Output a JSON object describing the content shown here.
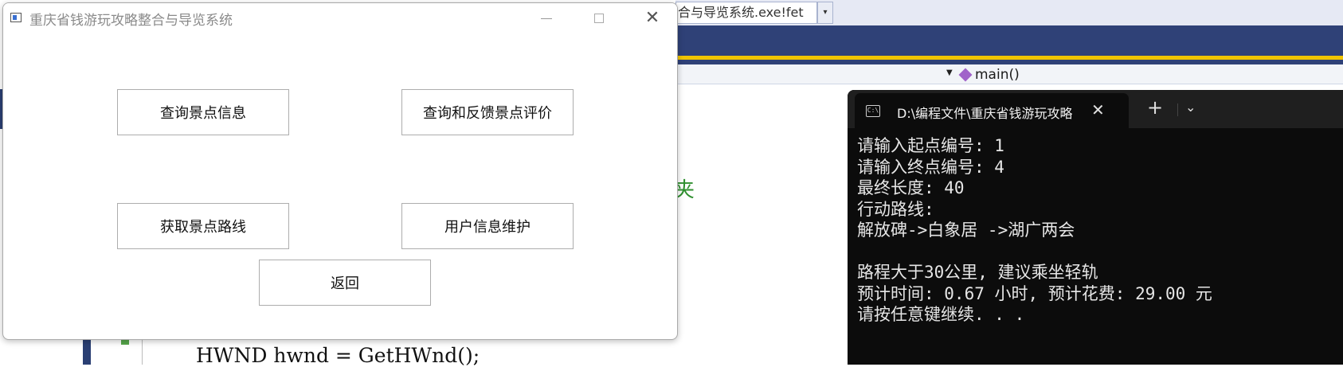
{
  "ide": {
    "combo_text": "合与导览系统.exe!fet",
    "nav_function": "main()",
    "green_char": "夹",
    "code_line": "HWND hwnd = GetHWnd();"
  },
  "dialog": {
    "title": "重庆省钱游玩攻略整合与导览系统",
    "buttons": {
      "query_spot": "查询景点信息",
      "review": "查询和反馈景点评价",
      "route": "获取景点路线",
      "user": "用户信息维护",
      "back": "返回"
    }
  },
  "terminal": {
    "tab_title": "D:\\编程文件\\重庆省钱游玩攻略",
    "lines": [
      "请输入起点编号: 1",
      "请输入终点编号: 4",
      "最终长度: 40",
      "行动路线:",
      "解放碑->白象居 ->湖广两会",
      "",
      "路程大于30公里, 建议乘坐轻轨",
      "预计时间: 0.67 小时, 预计花费: 29.00 元",
      "请按任意键继续. . ."
    ]
  }
}
